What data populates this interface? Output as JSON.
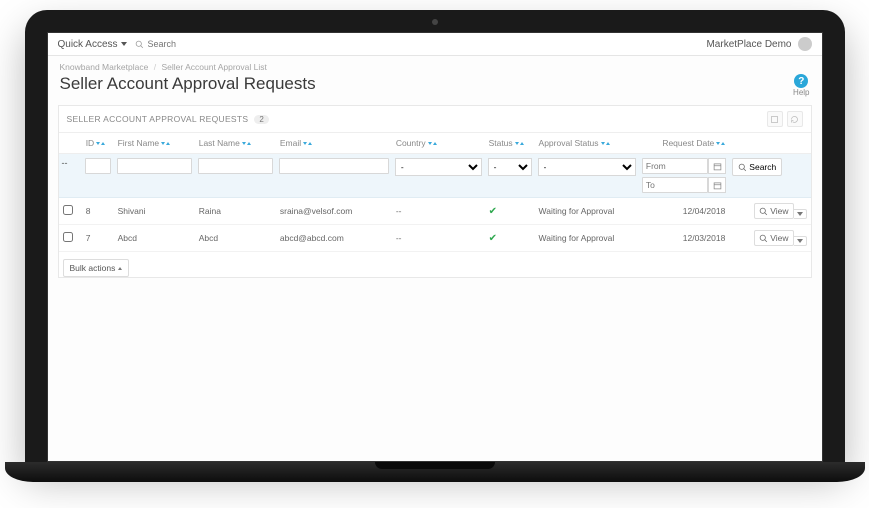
{
  "topbar": {
    "quick_access": "Quick Access",
    "search_placeholder": "Search",
    "user_label": "MarketPlace Demo"
  },
  "breadcrumb": {
    "a": "Knowband Marketplace",
    "b": "Seller Account Approval List"
  },
  "page": {
    "title": "Seller Account Approval Requests",
    "help": "Help"
  },
  "panel": {
    "title": "SELLER ACCOUNT APPROVAL REQUESTS",
    "count": "2"
  },
  "columns": {
    "id": "ID",
    "first_name": "First Name",
    "last_name": "Last Name",
    "email": "Email",
    "country": "Country",
    "status": "Status",
    "approval_status": "Approval Status",
    "request_date": "Request Date"
  },
  "filters": {
    "dash": "--",
    "select_default": "-",
    "from_placeholder": "From",
    "to_placeholder": "To",
    "search_btn": "Search"
  },
  "rows": [
    {
      "id": "8",
      "first_name": "Shivani",
      "last_name": "Raina",
      "email": "sraina@velsof.com",
      "country": "--",
      "approval_status": "Waiting for Approval",
      "request_date": "12/04/2018"
    },
    {
      "id": "7",
      "first_name": "Abcd",
      "last_name": "Abcd",
      "email": "abcd@abcd.com",
      "country": "--",
      "approval_status": "Waiting for Approval",
      "request_date": "12/03/2018"
    }
  ],
  "actions": {
    "view": "View",
    "bulk": "Bulk actions"
  }
}
